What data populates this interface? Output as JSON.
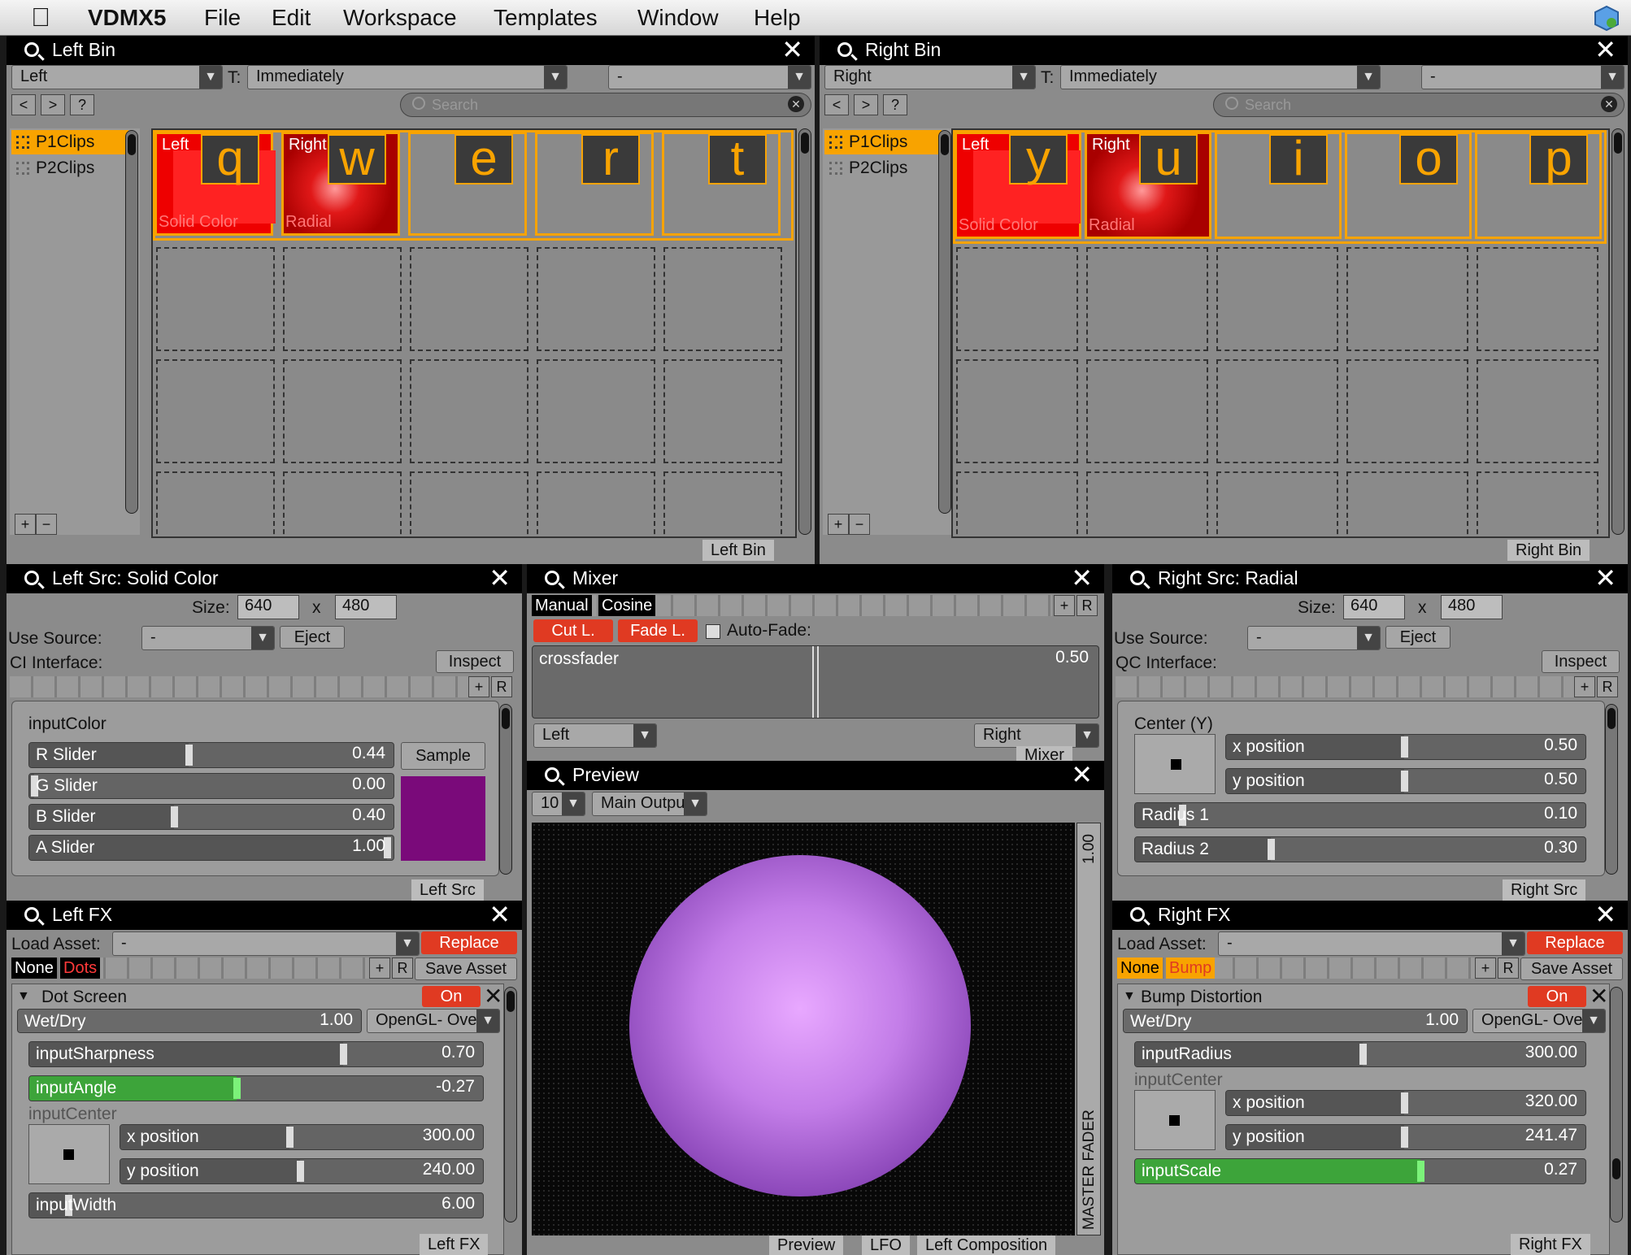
{
  "menubar": {
    "app": "VDMX5",
    "items": [
      "File",
      "Edit",
      "Workspace",
      "Templates",
      "Window",
      "Help"
    ]
  },
  "leftBin": {
    "title": "Left Bin",
    "layer": "Left",
    "trigger_label": "T:",
    "trigger": "Immediately",
    "extra": "-",
    "nav": [
      "<",
      ">",
      "?"
    ],
    "search_placeholder": "Search",
    "pages": [
      "P1Clips",
      "P2Clips"
    ],
    "add": "+",
    "remove": "−",
    "footer": "Left Bin",
    "clips": [
      {
        "key": "q",
        "top": "Left",
        "bottom": "Solid Color"
      },
      {
        "key": "w",
        "top": "Right",
        "bottom": "Radial"
      },
      {
        "key": "e"
      },
      {
        "key": "r"
      },
      {
        "key": "t"
      }
    ]
  },
  "rightBin": {
    "title": "Right Bin",
    "layer": "Right",
    "trigger_label": "T:",
    "trigger": "Immediately",
    "extra": "-",
    "nav": [
      "<",
      ">",
      "?"
    ],
    "search_placeholder": "Search",
    "pages": [
      "P1Clips",
      "P2Clips"
    ],
    "add": "+",
    "remove": "−",
    "footer": "Right Bin",
    "clips": [
      {
        "key": "y",
        "top": "Left",
        "bottom": "Solid Color"
      },
      {
        "key": "u",
        "top": "Right",
        "bottom": "Radial"
      },
      {
        "key": "i"
      },
      {
        "key": "o"
      },
      {
        "key": "p"
      }
    ]
  },
  "leftSrc": {
    "title": "Left Src: Solid Color",
    "size_label": "Size:",
    "width": "640",
    "x": "x",
    "height": "480",
    "use_source": "Use Source:",
    "source": "-",
    "eject": "Eject",
    "interface": "CI Interface:",
    "inspect": "Inspect",
    "plus": "+",
    "r": "R",
    "group": "inputColor",
    "sliders": [
      {
        "label": "R Slider",
        "value": "0.44",
        "pos": 0.44
      },
      {
        "label": "G Slider",
        "value": "0.00",
        "pos": 0.0
      },
      {
        "label": "B Slider",
        "value": "0.40",
        "pos": 0.4
      },
      {
        "label": "A Slider",
        "value": "1.00",
        "pos": 1.0
      }
    ],
    "sample": "Sample",
    "swatch": "#7a0a7a",
    "footer": "Left Src"
  },
  "mixer": {
    "title": "Mixer",
    "tabs": [
      "Manual",
      "Cosine"
    ],
    "plus": "+",
    "r": "R",
    "cut": "Cut L.",
    "fade": "Fade L.",
    "autofade": "Auto-Fade:",
    "fader_label": "crossfader",
    "fader_value": "0.50",
    "fader_pos": 0.5,
    "left": "Left",
    "right": "Right",
    "footer": "Mixer"
  },
  "preview": {
    "title": "Preview",
    "fps": "10",
    "output": "Main Output",
    "master_value": "1.00",
    "master_label": "MASTER FADER",
    "tabs": [
      "Preview",
      "LFO",
      "Left Composition"
    ]
  },
  "rightSrc": {
    "title": "Right Src: Radial",
    "size_label": "Size:",
    "width": "640",
    "x": "x",
    "height": "480",
    "use_source": "Use Source:",
    "source": "-",
    "eject": "Eject",
    "interface": "QC Interface:",
    "inspect": "Inspect",
    "plus": "+",
    "r": "R",
    "group": "Center (Y)",
    "xpos": {
      "label": "x position",
      "value": "0.50",
      "pos": 0.5
    },
    "ypos": {
      "label": "y position",
      "value": "0.50",
      "pos": 0.5
    },
    "radius1": {
      "label": "Radius 1",
      "value": "0.10",
      "pos": 0.1
    },
    "radius2": {
      "label": "Radius 2",
      "value": "0.30",
      "pos": 0.3
    },
    "footer": "Right Src"
  },
  "leftFx": {
    "title": "Left FX",
    "load": "Load Asset:",
    "asset": "-",
    "replace": "Replace",
    "tabs": [
      "None",
      "Dots"
    ],
    "plus": "+",
    "r": "R",
    "save": "Save Asset",
    "effect": "Dot Screen",
    "on": "On",
    "close": "✕",
    "wetdry": "Wet/Dry",
    "wetdry_value": "1.00",
    "blend": "OpenGL- Over",
    "sharp": {
      "label": "inputSharpness",
      "value": "0.70",
      "pos": 0.7
    },
    "angle": {
      "label": "inputAngle",
      "value": "-0.27",
      "pos": 0.46
    },
    "center": "inputCenter",
    "xpos": {
      "label": "x position",
      "value": "300.00",
      "pos": 0.47
    },
    "ypos": {
      "label": "y position",
      "value": "240.00",
      "pos": 0.5
    },
    "width": {
      "label": "inputWidth",
      "value": "6.00",
      "pos": 0.08
    },
    "footer": "Left FX"
  },
  "rightFx": {
    "title": "Right FX",
    "load": "Load Asset:",
    "asset": "-",
    "replace": "Replace",
    "tabs": [
      "None",
      "Bump"
    ],
    "plus": "+",
    "r": "R",
    "save": "Save Asset",
    "effect": "Bump Distortion",
    "on": "On",
    "close": "✕",
    "wetdry": "Wet/Dry",
    "wetdry_value": "1.00",
    "blend": "OpenGL- Over",
    "radius": {
      "label": "inputRadius",
      "value": "300.00",
      "pos": 0.51
    },
    "center": "inputCenter",
    "xpos": {
      "label": "x position",
      "value": "320.00",
      "pos": 0.5
    },
    "ypos": {
      "label": "y position",
      "value": "241.47",
      "pos": 0.5
    },
    "scale": {
      "label": "inputScale",
      "value": "0.27",
      "pos": 0.64
    },
    "footer": "Right FX"
  },
  "colors": {
    "accent": "#f8a300",
    "red": "#e03a22",
    "green": "#3da43a",
    "clip_red": "#cc0000"
  }
}
